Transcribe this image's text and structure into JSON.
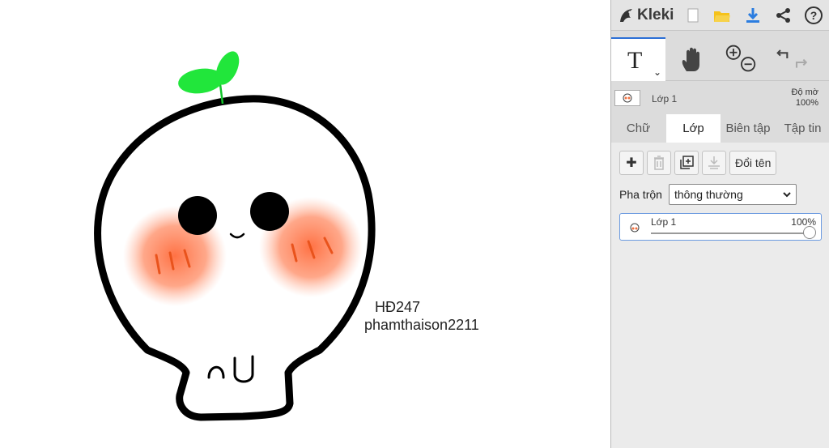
{
  "app": {
    "name": "Kleki",
    "icons": {
      "new": "new-image-icon",
      "open": "folder-icon",
      "save": "download-icon",
      "share": "share-icon",
      "help": "help-icon"
    }
  },
  "canvas": {
    "text_line_1": "HĐ247",
    "text_line_2": "phamthaison2211",
    "colors": {
      "sprout": "#21e63b",
      "blush": "#ff7a4d",
      "outline": "#000000"
    }
  },
  "tools": {
    "text_glyph": "T",
    "caret": "⌄",
    "icons": [
      "text-tool-icon",
      "hand-icon",
      "zoom-icon",
      "undo-redo-icon"
    ]
  },
  "layer_summary": {
    "name": "Lớp 1",
    "opacity_label": "Độ mờ",
    "opacity_value": "100%"
  },
  "tabs": [
    {
      "label": "Chữ",
      "active": false
    },
    {
      "label": "Lớp",
      "active": true
    },
    {
      "label": "Biên tập",
      "active": false
    },
    {
      "label": "Tập tin",
      "active": false
    }
  ],
  "layers_panel": {
    "buttons": [
      {
        "icon": "add-layer-icon",
        "glyph": "✚",
        "enabled": true
      },
      {
        "icon": "trash-icon",
        "glyph": "🗑",
        "enabled": false
      },
      {
        "icon": "duplicate-icon",
        "glyph": "⧉",
        "enabled": true
      },
      {
        "icon": "merge-down-icon",
        "glyph": "⤓",
        "enabled": false
      }
    ],
    "rename_label": "Đổi tên",
    "blend_label": "Pha trộn",
    "blend_value": "thông thường",
    "layers": [
      {
        "name": "Lớp 1",
        "opacity": "100%",
        "opacity_fraction": 1.0
      }
    ]
  },
  "accent_color": "#2b6fd6"
}
